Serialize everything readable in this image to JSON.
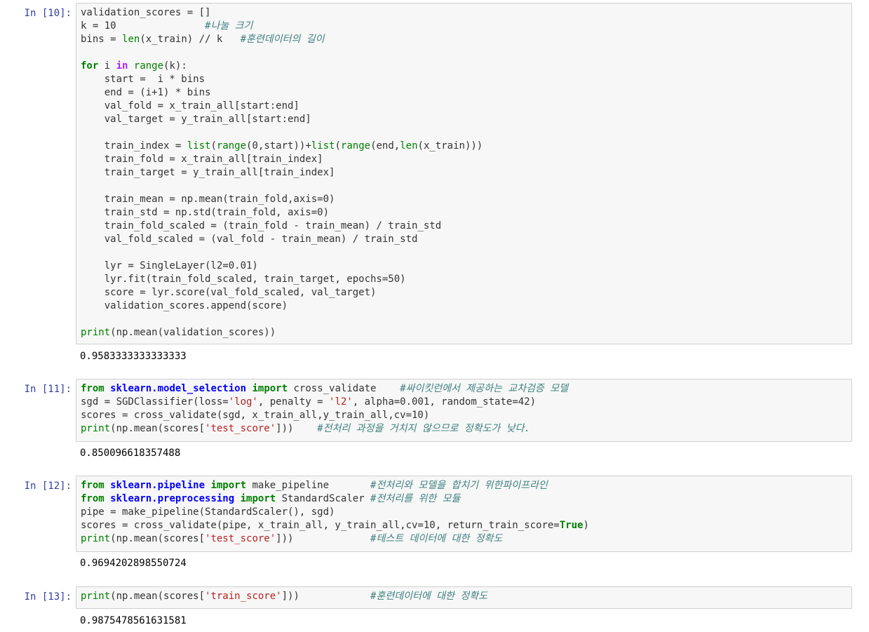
{
  "cells": [
    {
      "prompt": "In [10]:",
      "lines": [
        [
          [
            "validation_scores = []",
            "pl"
          ]
        ],
        [
          [
            "k = 10               ",
            "pl"
          ],
          [
            "#나눌 크기",
            "cm"
          ]
        ],
        [
          [
            "bins = ",
            "pl"
          ],
          [
            "len",
            "bi"
          ],
          [
            "(x_train) // k   ",
            "pl"
          ],
          [
            "#훈련데이터의 길이",
            "cm"
          ]
        ],
        [
          [
            "",
            "pl"
          ]
        ],
        [
          [
            "for",
            "kw"
          ],
          [
            " i ",
            "pl"
          ],
          [
            "in",
            "op"
          ],
          [
            " ",
            "pl"
          ],
          [
            "range",
            "bi"
          ],
          [
            "(k):",
            "pl"
          ]
        ],
        [
          [
            "    start =  i * bins",
            "pl"
          ]
        ],
        [
          [
            "    end = (i+1) * bins",
            "pl"
          ]
        ],
        [
          [
            "    val_fold = x_train_all[start:end]",
            "pl"
          ]
        ],
        [
          [
            "    val_target = y_train_all[start:end]",
            "pl"
          ]
        ],
        [
          [
            "",
            "pl"
          ]
        ],
        [
          [
            "    train_index = ",
            "pl"
          ],
          [
            "list",
            "bi"
          ],
          [
            "(",
            "pl"
          ],
          [
            "range",
            "bi"
          ],
          [
            "(0,start))+",
            "pl"
          ],
          [
            "list",
            "bi"
          ],
          [
            "(",
            "pl"
          ],
          [
            "range",
            "bi"
          ],
          [
            "(end,",
            "pl"
          ],
          [
            "len",
            "bi"
          ],
          [
            "(x_train)))",
            "pl"
          ]
        ],
        [
          [
            "    train_fold = x_train_all[train_index]",
            "pl"
          ]
        ],
        [
          [
            "    train_target = y_train_all[train_index]",
            "pl"
          ]
        ],
        [
          [
            "",
            "pl"
          ]
        ],
        [
          [
            "    train_mean = np.mean(train_fold,axis=0)",
            "pl"
          ]
        ],
        [
          [
            "    train_std = np.std(train_fold, axis=0)",
            "pl"
          ]
        ],
        [
          [
            "    train_fold_scaled = (train_fold - train_mean) / train_std",
            "pl"
          ]
        ],
        [
          [
            "    val_fold_scaled = (val_fold - train_mean) / train_std",
            "pl"
          ]
        ],
        [
          [
            "",
            "pl"
          ]
        ],
        [
          [
            "    lyr = SingleLayer(l2=0.01)",
            "pl"
          ]
        ],
        [
          [
            "    lyr.fit(train_fold_scaled, train_target, epochs=50)",
            "pl"
          ]
        ],
        [
          [
            "    score = lyr.score(val_fold_scaled, val_target)",
            "pl"
          ]
        ],
        [
          [
            "    validation_scores.append(score)",
            "pl"
          ]
        ],
        [
          [
            "",
            "pl"
          ]
        ],
        [
          [
            "print",
            "bi"
          ],
          [
            "(np.mean(validation_scores))",
            "pl"
          ]
        ]
      ],
      "output": "0.9583333333333333"
    },
    {
      "prompt": "In [11]:",
      "lines": [
        [
          [
            "from",
            "kw"
          ],
          [
            " ",
            "pl"
          ],
          [
            "sklearn.model_selection",
            "ns"
          ],
          [
            " ",
            "pl"
          ],
          [
            "import",
            "kw"
          ],
          [
            " cross_validate    ",
            "pl"
          ],
          [
            "#싸이킷런에서 제공하는 교차검증 모델",
            "cm"
          ]
        ],
        [
          [
            "sgd = SGDClassifier(loss=",
            "pl"
          ],
          [
            "'log'",
            "st"
          ],
          [
            ", penalty = ",
            "pl"
          ],
          [
            "'l2'",
            "st"
          ],
          [
            ", alpha=0.001, random_state=42)",
            "pl"
          ]
        ],
        [
          [
            "scores = cross_validate(sgd, x_train_all,y_train_all,cv=10)",
            "pl"
          ]
        ],
        [
          [
            "print",
            "bi"
          ],
          [
            "(np.mean(scores[",
            "pl"
          ],
          [
            "'test_score'",
            "st"
          ],
          [
            "]))    ",
            "pl"
          ],
          [
            "#전처리 과정을 거치지 않으므로 정확도가 낮다.",
            "cm"
          ]
        ]
      ],
      "output": "0.850096618357488"
    },
    {
      "prompt": "In [12]:",
      "lines": [
        [
          [
            "from",
            "kw"
          ],
          [
            " ",
            "pl"
          ],
          [
            "sklearn.pipeline",
            "ns"
          ],
          [
            " ",
            "pl"
          ],
          [
            "import",
            "kw"
          ],
          [
            " make_pipeline       ",
            "pl"
          ],
          [
            "#전처리와 모델을 합치기 위한파이프라인",
            "cm"
          ]
        ],
        [
          [
            "from",
            "kw"
          ],
          [
            " ",
            "pl"
          ],
          [
            "sklearn.preprocessing",
            "ns"
          ],
          [
            " ",
            "pl"
          ],
          [
            "import",
            "kw"
          ],
          [
            " StandardScaler ",
            "pl"
          ],
          [
            "#전처리를 위한 모듈",
            "cm"
          ]
        ],
        [
          [
            "pipe = make_pipeline(StandardScaler(), sgd)",
            "pl"
          ]
        ],
        [
          [
            "scores = cross_validate(pipe, x_train_all, y_train_all,cv=10, return_train_score=",
            "pl"
          ],
          [
            "True",
            "kw"
          ],
          [
            ")",
            "pl"
          ]
        ],
        [
          [
            "print",
            "bi"
          ],
          [
            "(np.mean(scores[",
            "pl"
          ],
          [
            "'test_score'",
            "st"
          ],
          [
            "]))             ",
            "pl"
          ],
          [
            "#테스트 데이터에 대한 정확도",
            "cm"
          ]
        ]
      ],
      "output": "0.9694202898550724"
    },
    {
      "prompt": "In [13]:",
      "lines": [
        [
          [
            "print",
            "bi"
          ],
          [
            "(np.mean(scores[",
            "pl"
          ],
          [
            "'train_score'",
            "st"
          ],
          [
            "]))            ",
            "pl"
          ],
          [
            "#훈련데이터에 대한 정확도",
            "cm"
          ]
        ]
      ],
      "output": "0.9875478561631581"
    }
  ]
}
